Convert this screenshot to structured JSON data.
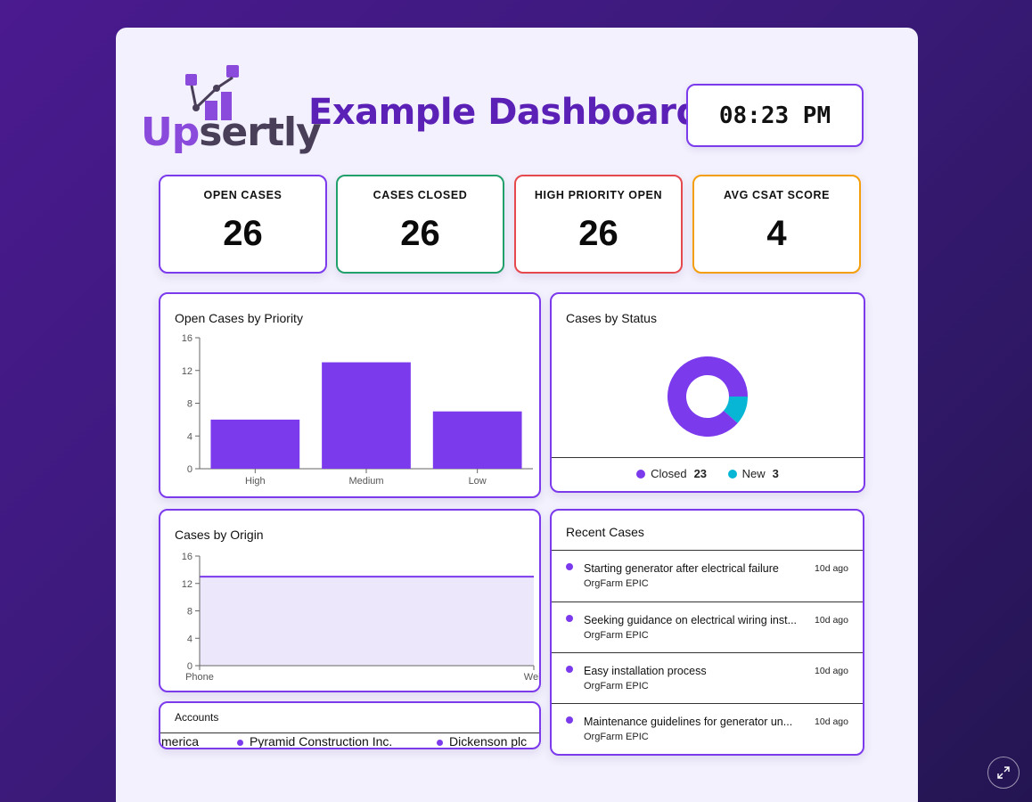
{
  "logo": {
    "up": "Up",
    "rest": "sertly"
  },
  "header": {
    "title": "Example Dashboard",
    "clock": "08:23 PM"
  },
  "kpis": [
    {
      "label": "OPEN CASES",
      "value": "26",
      "border": "#7c3aed"
    },
    {
      "label": "CASES CLOSED",
      "value": "26",
      "border": "#22a06b"
    },
    {
      "label": "HIGH PRIORITY OPEN",
      "value": "26",
      "border": "#e5484d"
    },
    {
      "label": "AVG CSAT SCORE",
      "value": "4",
      "border": "#f59e0b"
    }
  ],
  "priority_card": {
    "title": "Open Cases by Priority"
  },
  "status_card": {
    "title": "Cases by Status",
    "legend": [
      {
        "label": "Closed",
        "value": "23",
        "color": "#7c3aed"
      },
      {
        "label": "New",
        "value": "3",
        "color": "#06b6d4"
      }
    ]
  },
  "origin_card": {
    "title": "Cases by Origin"
  },
  "recent_card": {
    "title": "Recent Cases",
    "cases": [
      {
        "title": "Starting generator after electrical failure",
        "account": "OrgFarm EPIC",
        "time": "10d ago"
      },
      {
        "title": "Seeking guidance on electrical wiring inst...",
        "account": "OrgFarm EPIC",
        "time": "10d ago"
      },
      {
        "title": "Easy installation process",
        "account": "OrgFarm EPIC",
        "time": "10d ago"
      },
      {
        "title": "Maintenance guidelines for generator un...",
        "account": "OrgFarm EPIC",
        "time": "10d ago"
      }
    ]
  },
  "accounts_card": {
    "title": "Accounts",
    "ticker": [
      "merica",
      "Pyramid Construction Inc.",
      "Dickenson plc"
    ]
  },
  "chart_data": [
    {
      "type": "bar",
      "title": "Open Cases by Priority",
      "categories": [
        "High",
        "Medium",
        "Low"
      ],
      "values": [
        6,
        13,
        7
      ],
      "ylim": [
        0,
        16
      ],
      "yticks": [
        0,
        4,
        8,
        12,
        16
      ],
      "color": "#7c3aed",
      "grid": false
    },
    {
      "type": "pie",
      "title": "Cases by Status",
      "labels": [
        "Closed",
        "New"
      ],
      "values": [
        23,
        3
      ],
      "colors": [
        "#7c3aed",
        "#06b6d4"
      ],
      "donut": true
    },
    {
      "type": "area",
      "title": "Cases by Origin",
      "categories": [
        "Phone",
        "Web"
      ],
      "values": [
        13,
        13
      ],
      "ylim": [
        0,
        16
      ],
      "yticks": [
        0,
        4,
        8,
        12,
        16
      ],
      "color": "#7c3aed"
    }
  ]
}
